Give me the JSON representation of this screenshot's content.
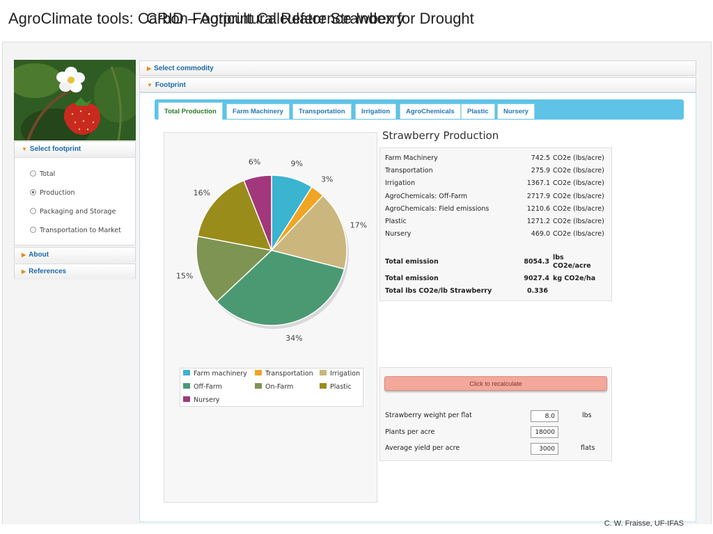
{
  "slide": {
    "title_a": "AgroClimate tools: Carbon Footprint Calculator Strawberry",
    "title_b": "CRID – Agricultural Reference Index for Drought",
    "credit": "C. W. Fraisse, UF-IFAS"
  },
  "sidebar": {
    "select_footprint": "Select footprint",
    "options": [
      {
        "label": "Total",
        "selected": false
      },
      {
        "label": "Production",
        "selected": true
      },
      {
        "label": "Packaging and Storage",
        "selected": false
      },
      {
        "label": "Transportation to Market",
        "selected": false
      }
    ],
    "about": "About",
    "references": "References"
  },
  "accordion": {
    "select_commodity": "Select commodity",
    "footprint": "Footprint"
  },
  "tabs": [
    "Total Production",
    "Farm Machinery",
    "Transportation",
    "Irrigation",
    "AgroChemicals",
    "Plastic",
    "Nursery"
  ],
  "production": {
    "title": "Strawberry Production",
    "rows": [
      {
        "label": "Farm Machinery",
        "value": "742.5",
        "unit": "CO2e (lbs/acre)"
      },
      {
        "label": "Transportation",
        "value": "275.9",
        "unit": "CO2e (lbs/acre)"
      },
      {
        "label": "Irrigation",
        "value": "1367.1",
        "unit": "CO2e (lbs/acre)"
      },
      {
        "label": "AgroChemicals: Off-Farm",
        "value": "2717.9",
        "unit": "CO2e (lbs/acre)"
      },
      {
        "label": "AgroChemicals: Field emissions",
        "value": "1210.6",
        "unit": "CO2e (lbs/acre)"
      },
      {
        "label": "Plastic",
        "value": "1271.2",
        "unit": "CO2e (lbs/acre)"
      },
      {
        "label": "Nursery",
        "value": "469.0",
        "unit": "CO2e (lbs/acre)"
      }
    ],
    "totals": [
      {
        "label": "Total emission",
        "value": "8054.3",
        "unit_line1": "lbs",
        "unit_line2": "CO2e/acre"
      },
      {
        "label": "Total emission",
        "value": "9027.4",
        "unit": "kg CO2e/ha"
      },
      {
        "label": "Total lbs CO2e/lb Strawberry",
        "value": "0.336",
        "unit": ""
      }
    ]
  },
  "calculator": {
    "recalc_label": "Click to recalculate",
    "fields": [
      {
        "label": "Strawberry weight per flat",
        "value": "8.0",
        "unit": "lbs"
      },
      {
        "label": "Plants per acre",
        "value": "18000",
        "unit": ""
      },
      {
        "label": "Average yield per acre",
        "value": "3000",
        "unit": "flats"
      }
    ]
  },
  "chart_data": {
    "type": "pie",
    "title": "",
    "slices": [
      {
        "name": "Farm machinery",
        "value": 9,
        "label": "9%",
        "color": "#3bb4cf"
      },
      {
        "name": "Transportation",
        "value": 3,
        "label": "3%",
        "color": "#f0a523"
      },
      {
        "name": "Irrigation",
        "value": 17,
        "label": "17%",
        "color": "#cbb77d"
      },
      {
        "name": "Off-Farm",
        "value": 34,
        "label": "34%",
        "color": "#4a9973"
      },
      {
        "name": "On-Farm",
        "value": 15,
        "label": "15%",
        "color": "#7d9453"
      },
      {
        "name": "Plastic",
        "value": 16,
        "label": "16%",
        "color": "#9a8c1a"
      },
      {
        "name": "Nursery",
        "value": 6,
        "label": "6%",
        "color": "#a2377c"
      }
    ],
    "legend": [
      "Farm machinery",
      "Transportation",
      "Irrigation",
      "Off-Farm",
      "On-Farm",
      "Plastic",
      "Nursery"
    ],
    "legend_position": "bottom"
  }
}
